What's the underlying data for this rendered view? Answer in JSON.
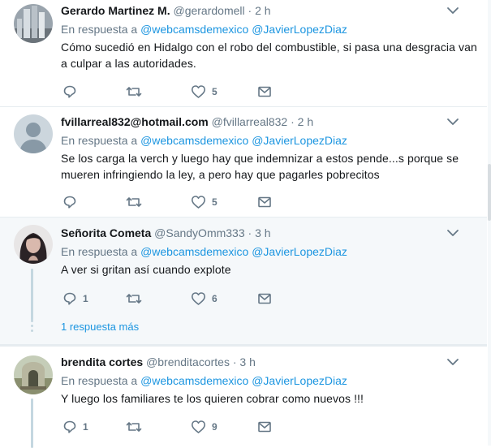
{
  "tweets": [
    {
      "fullname": "Gerardo Martinez M.",
      "username": "@gerardomell",
      "separator": "·",
      "time": "2 h",
      "reply_prefix": "En respuesta a",
      "reply_users": [
        "@webcamsdemexico",
        "@JavierLopezDiaz"
      ],
      "text_lines": [
        "Cómo sucedió en Hidalgo con el robo del combustible, si pasa una desgracia van",
        "a culpar a  las autoridades."
      ],
      "reply_count": "",
      "retweet_count": "",
      "like_count": "5"
    },
    {
      "fullname": "fvillarreal832@hotmail.com",
      "username": "@fvillarreal832",
      "separator": "·",
      "time": "2 h",
      "reply_prefix": "En respuesta a",
      "reply_users": [
        "@webcamsdemexico",
        "@JavierLopezDiaz"
      ],
      "text_lines": [
        "Se los carga la verch y luego hay que indemnizar a estos pende...s porque se",
        "mueren infringiendo la ley, a pero hay que pagarles pobrecitos"
      ],
      "reply_count": "",
      "retweet_count": "",
      "like_count": "5"
    },
    {
      "fullname": "Señorita Cometa",
      "username": "@SandyOmm333",
      "separator": "·",
      "time": "3 h",
      "reply_prefix": "En respuesta a",
      "reply_users": [
        "@webcamsdemexico",
        "@JavierLopezDiaz"
      ],
      "text_lines": [
        "A ver si gritan así cuando explote"
      ],
      "reply_count": "1",
      "retweet_count": "",
      "like_count": "6"
    },
    {
      "fullname": "brendita cortes",
      "username": "@brenditacortes",
      "separator": "·",
      "time": "3 h",
      "reply_prefix": "En respuesta a",
      "reply_users": [
        "@webcamsdemexico",
        "@JavierLopezDiaz"
      ],
      "text_lines": [
        "Y luego los familiares te los quieren cobrar como nuevos !!!"
      ],
      "reply_count": "1",
      "retweet_count": "",
      "like_count": "9"
    }
  ],
  "thread": {
    "more_replies_label": "1 respuesta más"
  },
  "icons": {
    "reply": "reply-icon",
    "retweet": "retweet-icon",
    "like": "heart-icon",
    "message": "envelope-icon",
    "caret": "chevron-down-icon"
  },
  "colors": {
    "link": "#1b95e0",
    "muted": "#657786",
    "text": "#14171a",
    "highlight_bg": "#f5f8fa"
  }
}
